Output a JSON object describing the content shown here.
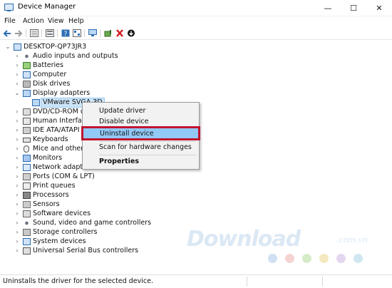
{
  "window": {
    "title": "Device Manager",
    "controls": {
      "minimize": "—",
      "maximize": "☐",
      "close": "✕"
    }
  },
  "menu": [
    "File",
    "Action",
    "View",
    "Help"
  ],
  "toolbar": {
    "icons": [
      "back-icon",
      "forward-icon",
      "properties-grid-icon",
      "device-list-icon",
      "help-icon",
      "device-view-icon",
      "monitor-icon",
      "update-driver-icon",
      "uninstall-x-icon",
      "enable-download-icon"
    ],
    "uninstall_color": "#d11a1a"
  },
  "tree": {
    "root": "DESKTOP-QP73JR3",
    "categories": [
      {
        "label": "Audio inputs and outputs",
        "icon": "speaker-icon"
      },
      {
        "label": "Batteries",
        "icon": "battery-icon"
      },
      {
        "label": "Computer",
        "icon": "computer-icon"
      },
      {
        "label": "Disk drives",
        "icon": "disk-icon"
      },
      {
        "label": "Display adapters",
        "icon": "display-adapter-icon",
        "expanded": true
      },
      {
        "label": "DVD/CD-ROM driv",
        "icon": "dvd-icon"
      },
      {
        "label": "Human Interface D",
        "icon": "hid-icon"
      },
      {
        "label": "IDE ATA/ATAPI cor",
        "icon": "ide-icon"
      },
      {
        "label": "Keyboards",
        "icon": "keyboard-icon"
      },
      {
        "label": "Mice and other po",
        "icon": "mouse-icon"
      },
      {
        "label": "Monitors",
        "icon": "monitor-icon"
      },
      {
        "label": "Network adapters",
        "icon": "network-icon"
      },
      {
        "label": "Ports (COM & LPT)",
        "icon": "ports-icon"
      },
      {
        "label": "Print queues",
        "icon": "printer-icon"
      },
      {
        "label": "Processors",
        "icon": "processor-icon"
      },
      {
        "label": "Sensors",
        "icon": "sensor-icon"
      },
      {
        "label": "Software devices",
        "icon": "software-icon"
      },
      {
        "label": "Sound, video and game controllers",
        "icon": "sound-icon"
      },
      {
        "label": "Storage controllers",
        "icon": "storage-icon"
      },
      {
        "label": "System devices",
        "icon": "system-icon"
      },
      {
        "label": "Universal Serial Bus controllers",
        "icon": "usb-icon"
      }
    ],
    "child_device": "VMware SVGA 3D"
  },
  "context_menu": {
    "items": [
      "Update driver",
      "Disable device",
      "Uninstall device",
      "Scan for hardware changes",
      "Properties"
    ],
    "highlighted": "Uninstall device",
    "highlight_color": "#91c9f7",
    "highlight_border": "#c0152f"
  },
  "watermark": {
    "text": "Download",
    "sub": ".com.vn",
    "dot_colors": [
      "#cfe0f0",
      "#f5d3d3",
      "#d6ecc9",
      "#f6e8bf",
      "#e3d6ef",
      "#cfe8f2"
    ]
  },
  "status": {
    "text": "Uninstalls the driver for the selected device."
  }
}
